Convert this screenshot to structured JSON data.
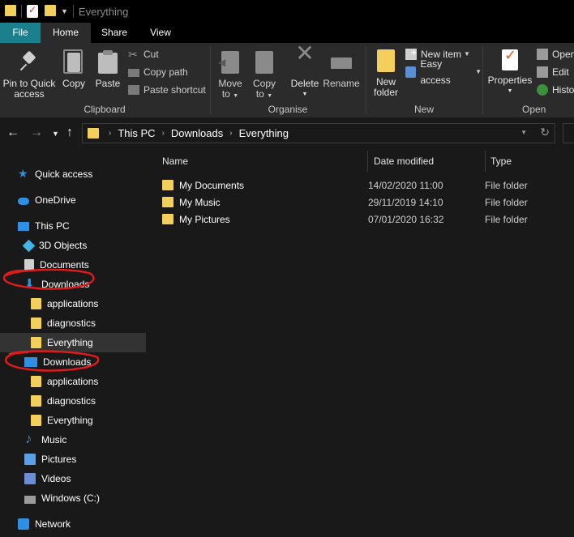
{
  "window": {
    "title": "Everything"
  },
  "ribbon_tabs": [
    "File",
    "Home",
    "Share",
    "View"
  ],
  "ribbon": {
    "clipboard": {
      "label": "Clipboard",
      "pin_line1": "Pin to Quick",
      "pin_line2": "access",
      "copy": "Copy",
      "paste": "Paste",
      "cut": "Cut",
      "copy_path": "Copy path",
      "paste_shortcut": "Paste shortcut"
    },
    "organise": {
      "label": "Organise",
      "move_to": "Move",
      "move_to2": "to",
      "copy_to": "Copy",
      "copy_to2": "to",
      "delete": "Delete",
      "rename": "Rename"
    },
    "new": {
      "label": "New",
      "new_folder1": "New",
      "new_folder2": "folder",
      "new_item": "New item",
      "easy_access": "Easy access"
    },
    "open": {
      "label": "Open",
      "properties": "Properties",
      "open": "Open",
      "edit": "Edit",
      "history": "Histor"
    }
  },
  "address": {
    "crumbs": [
      "This PC",
      "Downloads",
      "Everything"
    ]
  },
  "sidebar": {
    "items": [
      {
        "label": "Quick access",
        "icon": "star-icon"
      },
      {
        "label": "OneDrive",
        "icon": "cloud-icon"
      },
      {
        "label": "This PC",
        "icon": "pc-icon"
      },
      {
        "label": "3D Objects",
        "icon": "cube-icon"
      },
      {
        "label": "Documents",
        "icon": "documents-icon"
      },
      {
        "label": "Downloads",
        "icon": "download-icon"
      },
      {
        "label": "applications",
        "icon": "folder-icon"
      },
      {
        "label": "diagnostics",
        "icon": "folder-icon"
      },
      {
        "label": "Everything",
        "icon": "folder-icon"
      },
      {
        "label": "Downloads",
        "icon": "monitor-icon"
      },
      {
        "label": "applications",
        "icon": "folder-icon"
      },
      {
        "label": "diagnostics",
        "icon": "folder-icon"
      },
      {
        "label": "Everything",
        "icon": "folder-icon"
      },
      {
        "label": "Music",
        "icon": "music-icon"
      },
      {
        "label": "Pictures",
        "icon": "pictures-icon"
      },
      {
        "label": "Videos",
        "icon": "videos-icon"
      },
      {
        "label": "Windows (C:)",
        "icon": "drive-icon"
      },
      {
        "label": "Network",
        "icon": "network-icon"
      }
    ]
  },
  "columns": {
    "name": "Name",
    "date": "Date modified",
    "type": "Type"
  },
  "files": [
    {
      "name": "My Documents",
      "date": "14/02/2020 11:00",
      "type": "File folder"
    },
    {
      "name": "My Music",
      "date": "29/11/2019 14:10",
      "type": "File folder"
    },
    {
      "name": "My Pictures",
      "date": "07/01/2020 16:32",
      "type": "File folder"
    }
  ],
  "colors": {
    "accent_file_tab": "#1b7f8c",
    "folder": "#f3cf5b",
    "annotation": "#e01b1b"
  }
}
